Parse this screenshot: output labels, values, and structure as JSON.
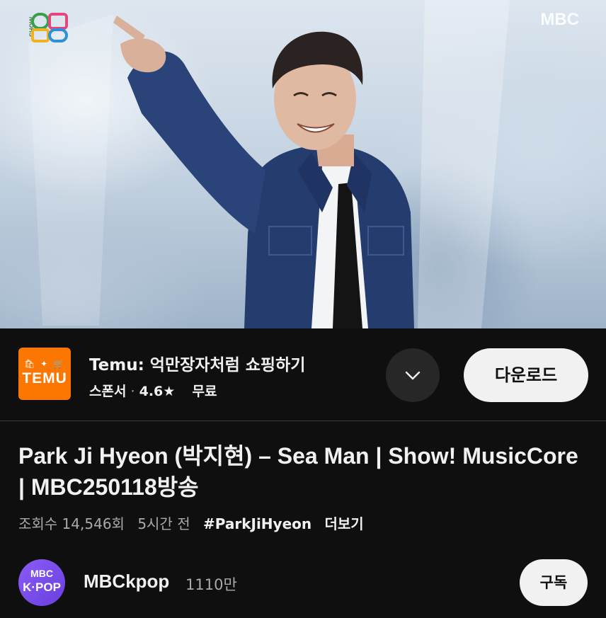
{
  "video": {
    "show_logo_lines": [
      "SHOW",
      "음중"
    ],
    "broadcaster_watermark": "MBC"
  },
  "ad": {
    "logo_top": "🛍 ✦ 🛒",
    "logo_text": "TEMU",
    "title": "Temu: 억만장자처럼 쇼핑하기",
    "sponsor_label": "스폰서",
    "separator": "·",
    "rating": "4.6★",
    "price": "무료",
    "expand_icon": "chevron-down-icon",
    "download_label": "다운로드",
    "brand_color": "#fb7701"
  },
  "title": "Park Ji Hyeon (박지현) – Sea Man | Show! MusicCore | MBC250118방송",
  "meta": {
    "views": "조회수 14,546회",
    "time": "5시간 전",
    "hashtag": "#ParkJiHyeon",
    "more": "더보기"
  },
  "channel": {
    "avatar_line1": "MBC",
    "avatar_line2": "K·POP",
    "name": "MBCkpop",
    "subscribers": "1110만",
    "subscribe_label": "구독"
  }
}
